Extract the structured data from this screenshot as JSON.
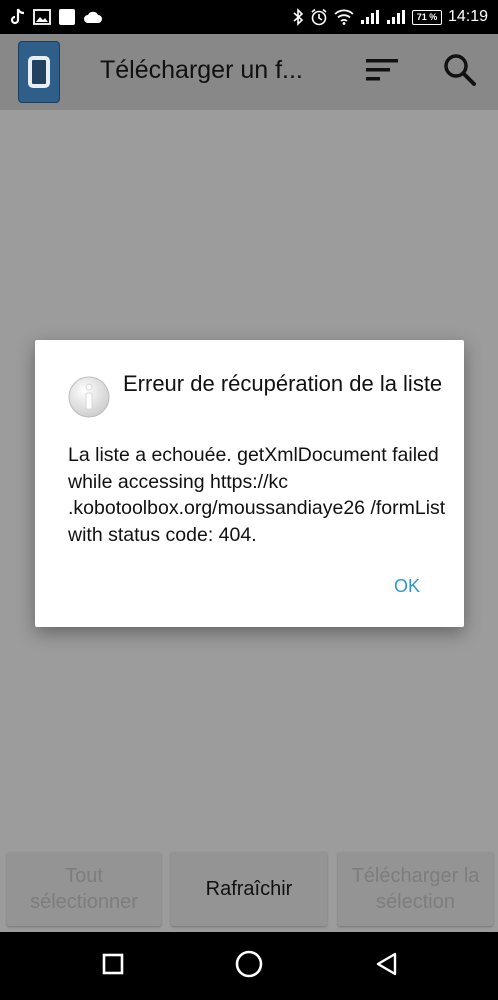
{
  "status_bar": {
    "left_icons": [
      "tiktok-icon",
      "image-icon",
      "square-notification-icon",
      "cloud-icon"
    ],
    "right_icons": [
      "bluetooth-icon",
      "alarm-icon",
      "wifi-icon",
      "signal-icon",
      "signal-icon"
    ],
    "battery_percent": "71 %",
    "time": "14:19"
  },
  "app_bar": {
    "title": "Télécharger un f...",
    "actions": [
      "sort-icon",
      "search-icon"
    ]
  },
  "dialog": {
    "icon": "info-icon",
    "title": "Erreur de récupération de la liste",
    "message": "La liste a echouée. getXmlDocument failed while accessing https://kc .kobotoolbox.org/moussandiaye26 /formList with status code: 404.",
    "ok_label": "OK"
  },
  "bottom_buttons": {
    "select_all": "Tout sélectionner",
    "refresh": "Rafraîchir",
    "download_selection": "Télécharger la sélection"
  },
  "nav_bar": {
    "buttons": [
      "recents-icon",
      "home-icon",
      "back-icon"
    ]
  },
  "colors": {
    "scrim": "#9c9c9c",
    "app_bar": "#888888",
    "accent": "#2f97c7",
    "logo": "#2f5e88"
  }
}
